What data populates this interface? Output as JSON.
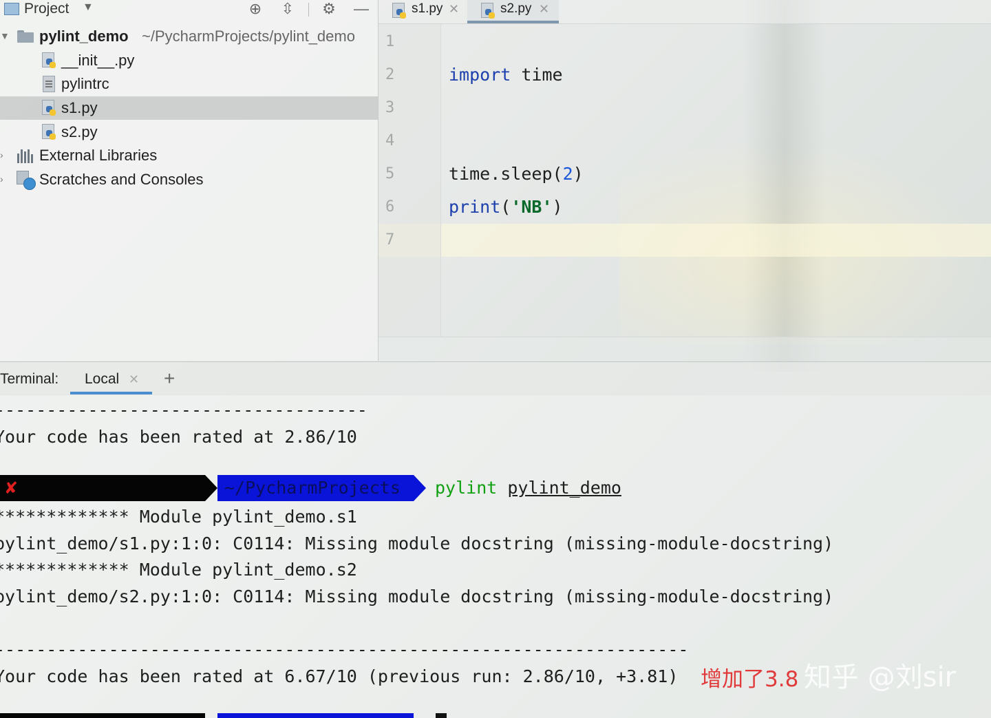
{
  "project_panel": {
    "title": "Project",
    "tree": [
      {
        "label": "pylint_demo",
        "path": "~/PycharmProjects/pylint_demo",
        "kind": "folder",
        "expanded": true
      },
      {
        "label": "__init__.py",
        "kind": "python-file"
      },
      {
        "label": "pylintrc",
        "kind": "text-file"
      },
      {
        "label": "s1.py",
        "kind": "python-file",
        "selected": true
      },
      {
        "label": "s2.py",
        "kind": "python-file"
      },
      {
        "label": "External Libraries",
        "kind": "libraries"
      },
      {
        "label": "Scratches and Consoles",
        "kind": "scratches"
      }
    ]
  },
  "editor": {
    "tabs": [
      {
        "label": "s1.py",
        "active": false
      },
      {
        "label": "s2.py",
        "active": true
      }
    ],
    "line_numbers": [
      "1",
      "2",
      "3",
      "4",
      "5",
      "6",
      "7"
    ],
    "code": {
      "l2_kw": "import",
      "l2_rest": " time",
      "l5_a": "time.sleep(",
      "l5_num": "2",
      "l5_b": ")",
      "l6_kw": "print",
      "l6_a": "(",
      "l6_str": "'NB'",
      "l6_b": ")"
    },
    "current_line": 7
  },
  "terminal": {
    "label": "Terminal:",
    "tab_label": "Local",
    "lines": {
      "l1": "------------------------------------",
      "l2": "Your code has been rated at 2.86/10",
      "l4": "************* Module pylint_demo.s1",
      "l5": "pylint_demo/s1.py:1:0: C0114: Missing module docstring (missing-module-docstring)",
      "l6": "************* Module pylint_demo.s2",
      "l7": "pylint_demo/s2.py:1:0: C0114: Missing module docstring (missing-module-docstring)",
      "l8": "-------------------------------------------------------------------",
      "l9": "Your code has been rated at 6.67/10 (previous run: 2.86/10, +3.81)"
    },
    "prompt": {
      "status": "✘",
      "cwd": "~/PycharmProjects",
      "cmd_name": "pylint",
      "cmd_arg": "pylint_demo"
    }
  },
  "annotation": {
    "note": "增加了3.8",
    "watermark": "知乎 @刘sir"
  },
  "colors": {
    "keyword": "#1c3fad",
    "number": "#1b56d8",
    "string": "#0b6a2b",
    "note_red": "#e03a3a",
    "prompt_blue": "#0a14d8",
    "cmd_green": "#12a012",
    "tab_underline": "#4a8ed0"
  }
}
